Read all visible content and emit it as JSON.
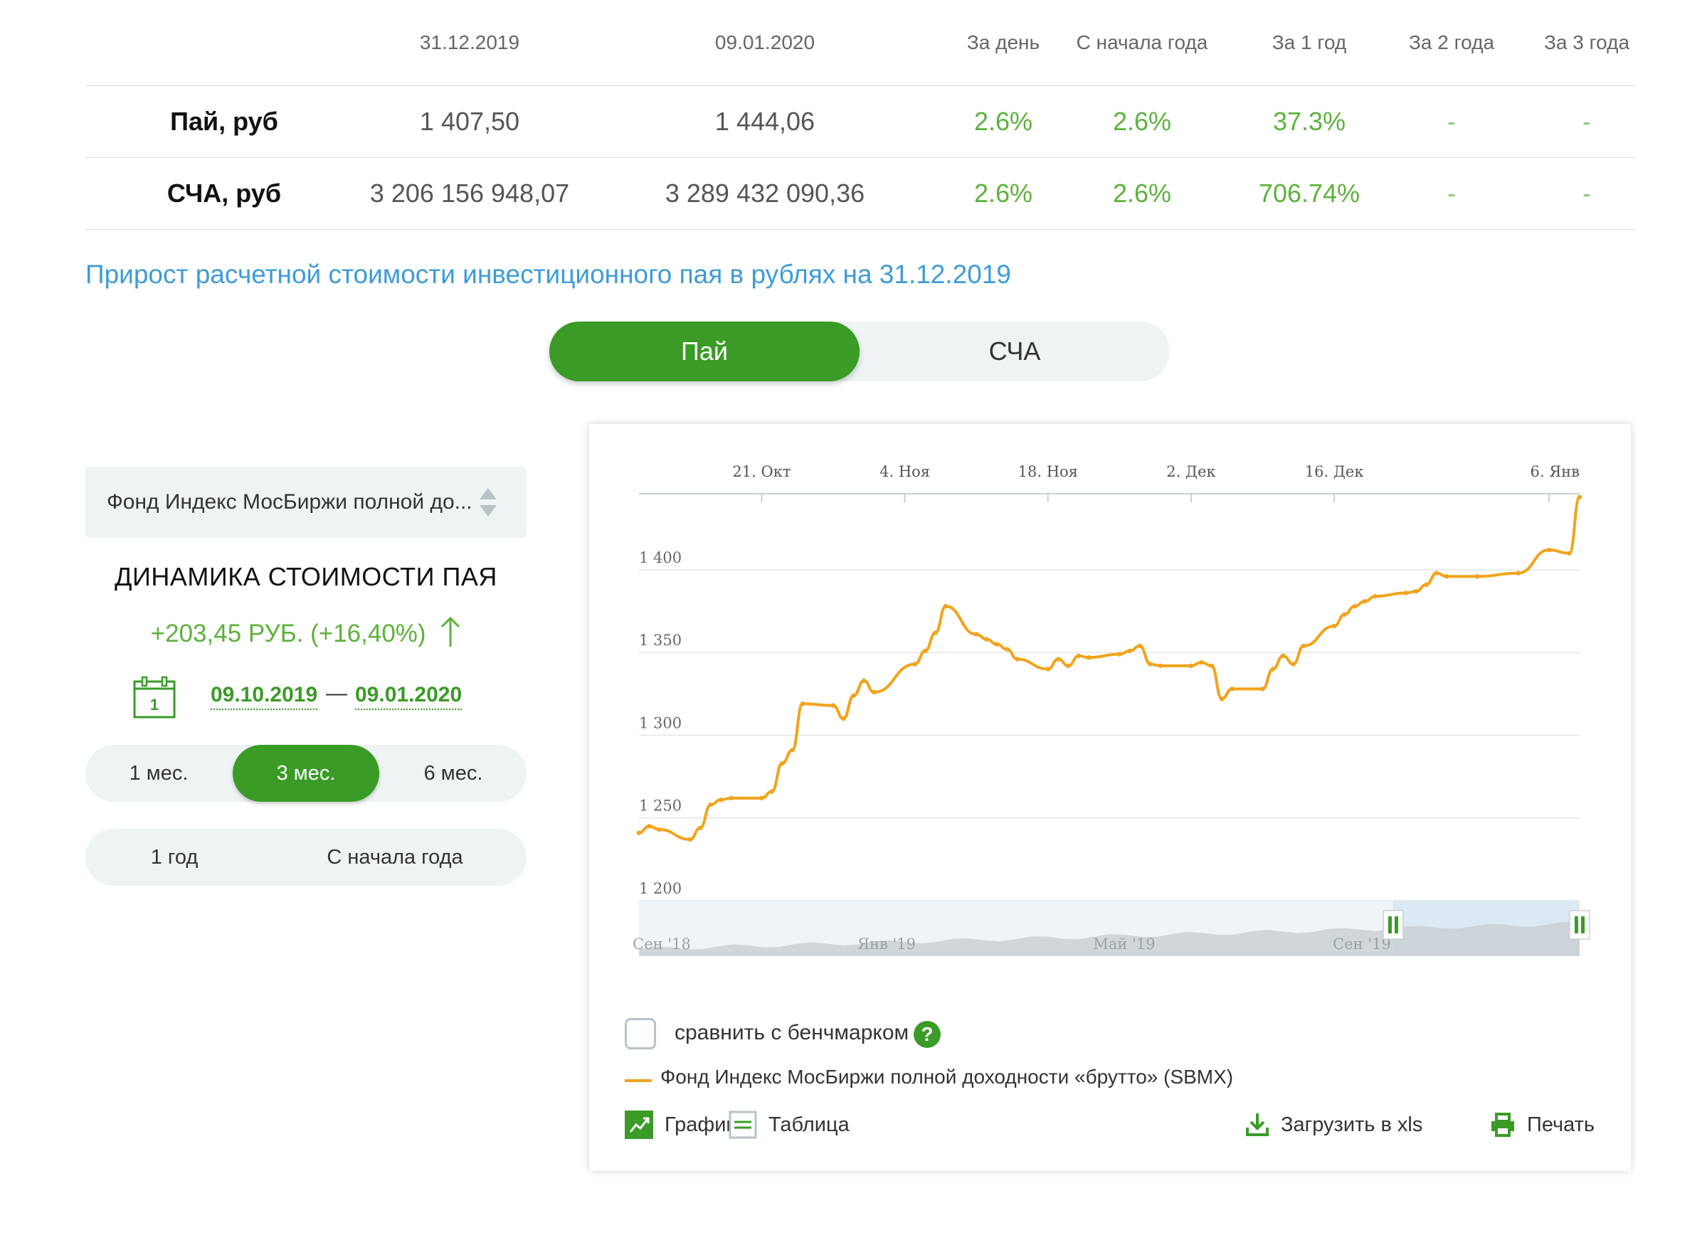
{
  "summary": {
    "headers": [
      "",
      "31.12.2019",
      "09.01.2020",
      "За день",
      "С начала года",
      "За 1 год",
      "За 2 года",
      "За 3 года"
    ],
    "rows": [
      {
        "label": "Пай, руб",
        "v1": "1 407,50",
        "v2": "1 444,06",
        "day": "2.6%",
        "ytd": "2.6%",
        "y1": "37.3%",
        "y2": "-",
        "y3": "-"
      },
      {
        "label": "СЧА, руб",
        "v1": "3 206 156 948,07",
        "v2": "3 289 432 090,36",
        "day": "2.6%",
        "ytd": "2.6%",
        "y1": "706.74%",
        "y2": "-",
        "y3": "-"
      }
    ]
  },
  "section_title": "Прирост расчетной стоимости инвестиционного пая в рублях на 31.12.2019",
  "toggle": {
    "active": "Пай",
    "inactive": "СЧА"
  },
  "fund_select": {
    "value": "Фонд Индекс МосБиржи полной до..."
  },
  "dynamics": {
    "title": "ДИНАМИКА СТОИМОСТИ ПАЯ",
    "change": "+203,45 РУБ. (+16,40%)",
    "calendar_day": "1",
    "date_from": "09.10.2019",
    "date_sep": "—",
    "date_to": "09.01.2020"
  },
  "periods": {
    "m1": "1 мес.",
    "m3": "3 мес.",
    "m6": "6 мес.",
    "y1": "1 год",
    "ytd": "С начала года",
    "active": "3 мес."
  },
  "chart_data": {
    "type": "line",
    "x_ticks": [
      "21. Окт",
      "4. Ноя",
      "18. Ноя",
      "2. Дек",
      "16. Дек",
      "6. Янв"
    ],
    "y_ticks": [
      1200,
      1250,
      1300,
      1350,
      1400
    ],
    "y_tick_labels": [
      "1 200",
      "1 250",
      "1 300",
      "1 350",
      "1 400"
    ],
    "ylim": [
      1200,
      1446
    ],
    "x": [
      "2019-10-09",
      "2019-10-10",
      "2019-10-11",
      "2019-10-14",
      "2019-10-15",
      "2019-10-16",
      "2019-10-17",
      "2019-10-18",
      "2019-10-21",
      "2019-10-22",
      "2019-10-23",
      "2019-10-24",
      "2019-10-25",
      "2019-10-28",
      "2019-10-29",
      "2019-10-30",
      "2019-10-31",
      "2019-11-01",
      "2019-11-05",
      "2019-11-06",
      "2019-11-07",
      "2019-11-08",
      "2019-11-11",
      "2019-11-12",
      "2019-11-13",
      "2019-11-14",
      "2019-11-15",
      "2019-11-18",
      "2019-11-19",
      "2019-11-20",
      "2019-11-21",
      "2019-11-22",
      "2019-11-25",
      "2019-11-26",
      "2019-11-27",
      "2019-11-28",
      "2019-11-29",
      "2019-12-02",
      "2019-12-03",
      "2019-12-04",
      "2019-12-05",
      "2019-12-06",
      "2019-12-09",
      "2019-12-10",
      "2019-12-11",
      "2019-12-12",
      "2019-12-13",
      "2019-12-16",
      "2019-12-17",
      "2019-12-18",
      "2019-12-19",
      "2019-12-20",
      "2019-12-23",
      "2019-12-24",
      "2019-12-25",
      "2019-12-26",
      "2019-12-27",
      "2019-12-30",
      "2020-01-03",
      "2020-01-06",
      "2020-01-08",
      "2020-01-09"
    ],
    "values": [
      1241,
      1245,
      1243,
      1237,
      1244,
      1258,
      1261,
      1262,
      1262,
      1266,
      1283,
      1291,
      1319,
      1318,
      1310,
      1324,
      1333,
      1326,
      1343,
      1351,
      1362,
      1378,
      1361,
      1358,
      1355,
      1352,
      1346,
      1340,
      1346,
      1342,
      1348,
      1347,
      1349,
      1351,
      1354,
      1343,
      1342,
      1342,
      1344,
      1342,
      1322,
      1328,
      1328,
      1340,
      1348,
      1343,
      1354,
      1366,
      1373,
      1378,
      1381,
      1384,
      1386,
      1387,
      1391,
      1398,
      1396,
      1396,
      1398,
      1412,
      1410,
      1444
    ],
    "navigator": {
      "labels": [
        "Сен '18",
        "Янв '19",
        "Май '19",
        "Сен '19"
      ]
    },
    "series": [
      {
        "name": "Фонд Индекс МосБиржи полной доходности «брутто» (SBMX)"
      }
    ],
    "color": "#f2a31a",
    "grid": true
  },
  "benchmark": {
    "label": "сравнить с бенчмарком",
    "help": "?"
  },
  "legend": {
    "name": "Фонд Индекс МосБиржи полной доходности «брутто» (SBMX)"
  },
  "tools": {
    "chart": "График",
    "table": "Таблица",
    "download": "Загрузить в xls",
    "print": "Печать"
  },
  "colors": {
    "green": "#3a9b26",
    "green_text": "#5cb13b",
    "link_blue": "#3d9bd9",
    "line": "#f2a31a"
  }
}
